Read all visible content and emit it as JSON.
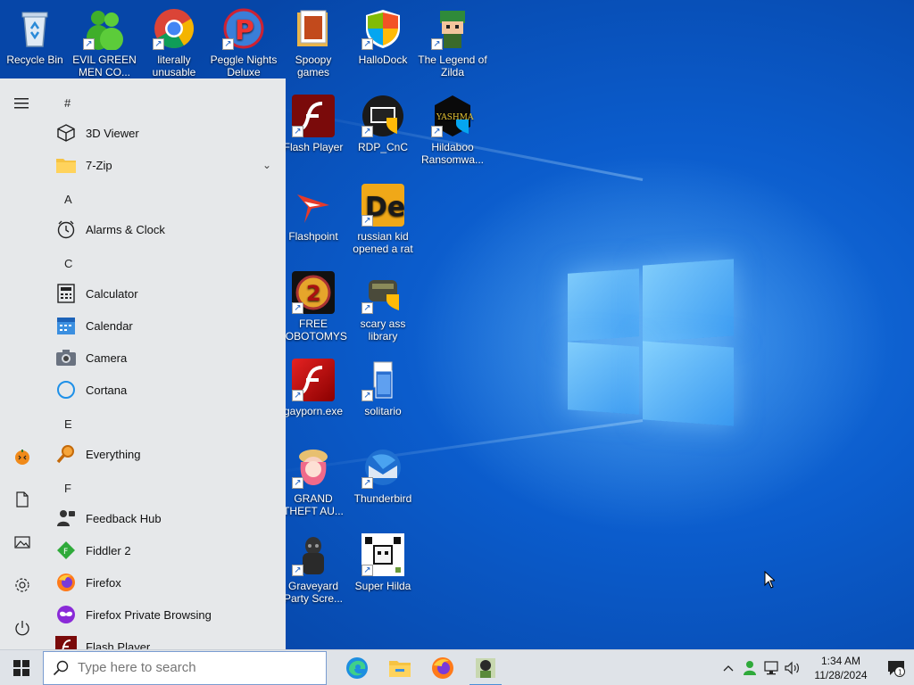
{
  "desktop": {
    "icons": [
      {
        "label": "Recycle Bin",
        "icon": "recycle-bin-icon"
      },
      {
        "label": "EVIL GREEN MEN CO...",
        "icon": "green-men-icon"
      },
      {
        "label": "literally unusable",
        "icon": "chrome-icon"
      },
      {
        "label": "Peggle Nights Deluxe",
        "icon": "peggle-icon"
      },
      {
        "label": "Spoopy games",
        "icon": "folder-icon"
      },
      {
        "label": "HalloDock",
        "icon": "shield-icon"
      },
      {
        "label": "The Legend of Zilda",
        "icon": "zilda-icon"
      },
      {
        "label": "Flash Player",
        "icon": "flash-icon"
      },
      {
        "label": "RDP_CnC",
        "icon": "rdp-icon"
      },
      {
        "label": "Hildaboo Ransomwa...",
        "icon": "ransomware-icon"
      },
      {
        "label": "Flashpoint",
        "icon": "flashpoint-icon"
      },
      {
        "label": "russian kid opened a rat",
        "icon": "de-icon"
      },
      {
        "label": "FREE LOBOTOMYS",
        "icon": "lobotomy-icon"
      },
      {
        "label": "scary ass library",
        "icon": "library-icon"
      },
      {
        "label": "gayporn.exe",
        "icon": "flash-icon"
      },
      {
        "label": "solitario",
        "icon": "solitaire-icon"
      },
      {
        "label": "GRAND THEFT AU...",
        "icon": "gta-icon"
      },
      {
        "label": "Thunderbird",
        "icon": "thunderbird-icon"
      },
      {
        "label": "Graveyard Party Scre...",
        "icon": "graveyard-icon"
      },
      {
        "label": "Super Hilda",
        "icon": "super-hilda-icon"
      }
    ]
  },
  "startmenu": {
    "sections": [
      {
        "letter": "#"
      },
      {
        "letter": "A"
      },
      {
        "letter": "C"
      },
      {
        "letter": "E"
      },
      {
        "letter": "F"
      }
    ],
    "apps": [
      {
        "label": "3D Viewer",
        "icon": "cube-icon"
      },
      {
        "label": "7-Zip",
        "icon": "folder-icon",
        "expandable": true
      },
      {
        "label": "Alarms & Clock",
        "icon": "clock-icon"
      },
      {
        "label": "Calculator",
        "icon": "calculator-icon"
      },
      {
        "label": "Calendar",
        "icon": "calendar-icon"
      },
      {
        "label": "Camera",
        "icon": "camera-icon"
      },
      {
        "label": "Cortana",
        "icon": "cortana-icon"
      },
      {
        "label": "Everything",
        "icon": "magnifier-icon"
      },
      {
        "label": "Feedback Hub",
        "icon": "feedback-icon"
      },
      {
        "label": "Fiddler 2",
        "icon": "fiddler-icon"
      },
      {
        "label": "Firefox",
        "icon": "firefox-icon"
      },
      {
        "label": "Firefox Private Browsing",
        "icon": "firefox-private-icon"
      },
      {
        "label": "Flash Player",
        "icon": "flash-icon"
      }
    ],
    "rail": [
      "hamburger-icon",
      "user-avatar-icon",
      "documents-icon",
      "pictures-icon",
      "settings-icon",
      "power-icon"
    ]
  },
  "taskbar": {
    "search_placeholder": "Type here to search",
    "pinned": [
      "edge-icon",
      "file-explorer-icon",
      "firefox-icon",
      "hilda-app-icon"
    ],
    "time": "1:34 AM",
    "date": "11/28/2024",
    "notification_count": "1"
  },
  "colors": {
    "wallpaper": "#0b5ccc",
    "startmenu_bg": "#e6e8ea",
    "taskbar_bg": "#dfe3e8"
  }
}
